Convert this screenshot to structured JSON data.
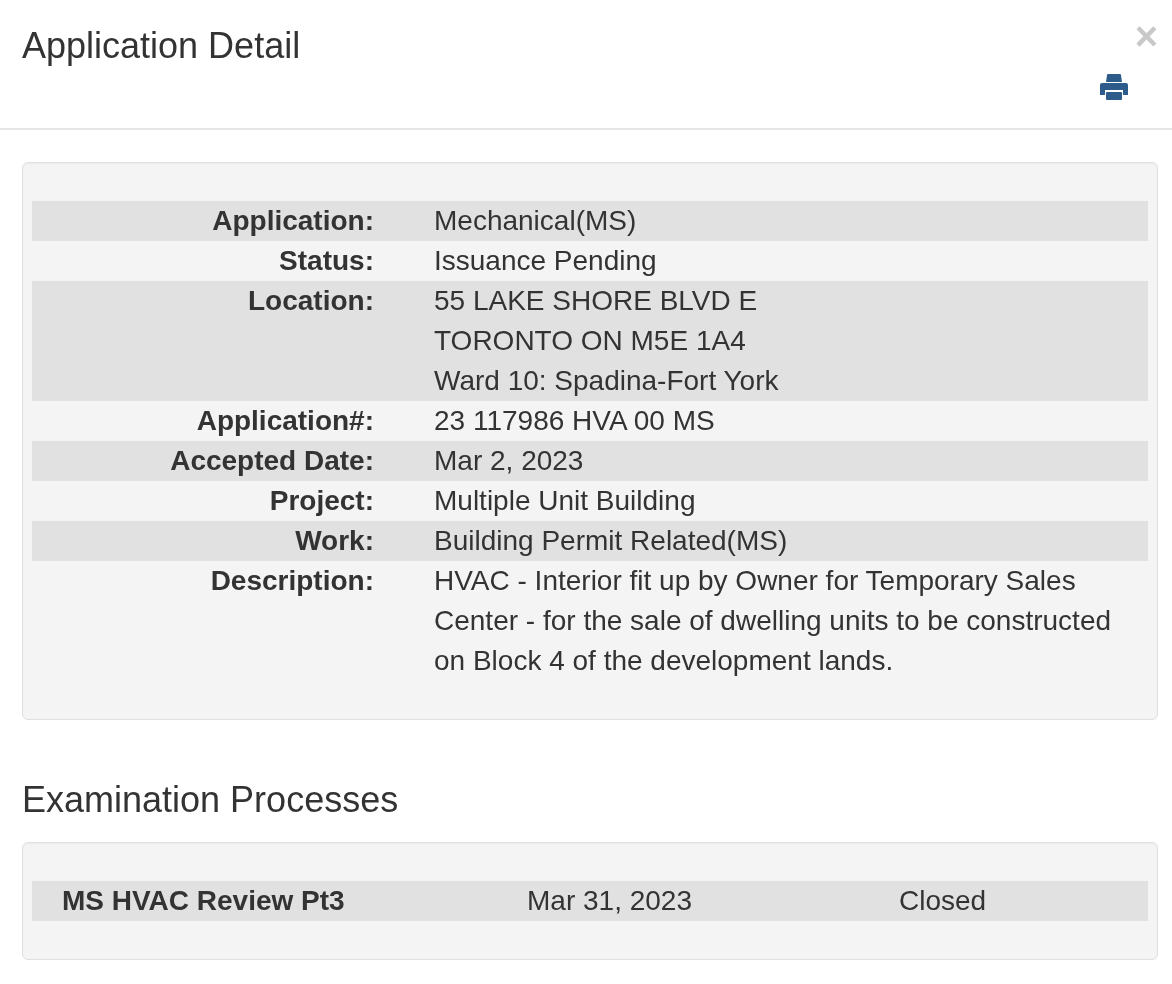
{
  "header": {
    "title": "Application Detail",
    "close": "×"
  },
  "details": {
    "rows": [
      {
        "label": "Application:",
        "lines": [
          "Mechanical(MS)"
        ]
      },
      {
        "label": "Status:",
        "lines": [
          "Issuance Pending"
        ]
      },
      {
        "label": "Location:",
        "lines": [
          "55 LAKE SHORE BLVD E",
          "TORONTO ON M5E 1A4",
          "Ward 10: Spadina-Fort York"
        ]
      },
      {
        "label": "Application#:",
        "lines": [
          "23 117986 HVA 00 MS"
        ]
      },
      {
        "label": "Accepted Date:",
        "lines": [
          "Mar 2, 2023"
        ]
      },
      {
        "label": "Project:",
        "lines": [
          "Multiple Unit Building"
        ]
      },
      {
        "label": "Work:",
        "lines": [
          "Building Permit Related(MS)"
        ]
      },
      {
        "label": "Description:",
        "lines": [
          "HVAC - Interior fit up by Owner for Temporary Sales Center - for the sale of dwelling units to be constructed on Block 4 of the development lands."
        ]
      }
    ]
  },
  "examination": {
    "heading": "Examination Processes",
    "rows": [
      {
        "process": "MS HVAC Review Pt3",
        "date": "Mar 31, 2023",
        "status": "Closed"
      }
    ]
  }
}
